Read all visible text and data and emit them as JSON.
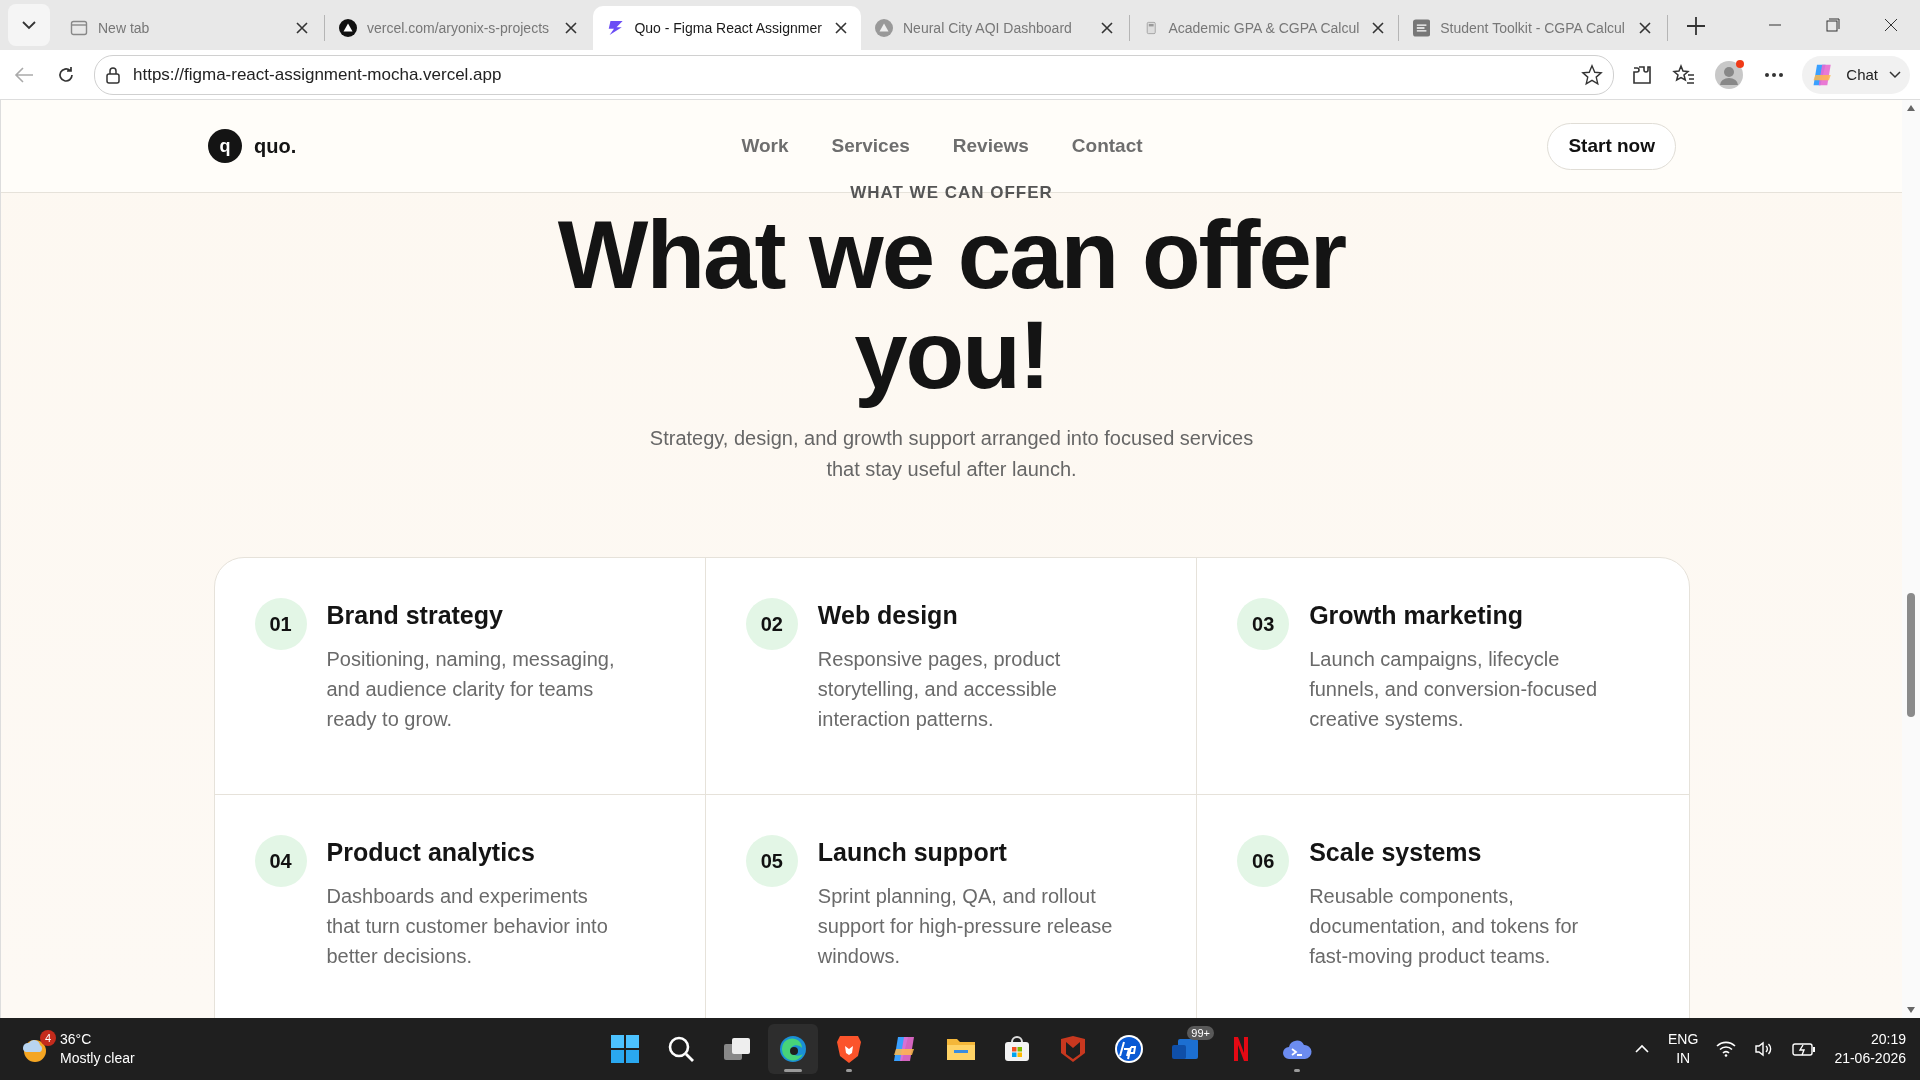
{
  "browser": {
    "tabs": [
      {
        "title": "New tab",
        "kind": "newtab",
        "selected": false
      },
      {
        "title": "vercel.com/aryonix-s-projects",
        "kind": "vercel",
        "selected": false
      },
      {
        "title": "Quo - Figma React Assignmer",
        "kind": "bolt",
        "selected": true
      },
      {
        "title": "Neural City AQI Dashboard",
        "kind": "triangle",
        "selected": false
      },
      {
        "title": "Academic GPA & CGPA Calcul",
        "kind": "calc",
        "selected": false
      },
      {
        "title": "Student Toolkit - CGPA Calcul",
        "kind": "doc",
        "selected": false
      }
    ],
    "address": "https://figma-react-assignment-mocha.vercel.app",
    "chat_label": "Chat",
    "profile_alert": true
  },
  "site": {
    "logo_mark": "q",
    "logo_text": "quo.",
    "nav": [
      "Work",
      "Services",
      "Reviews",
      "Contact"
    ],
    "cta": "Start now"
  },
  "hero": {
    "eyebrow": "WHAT WE CAN OFFER",
    "title_lines": [
      "What we can offer",
      "you!"
    ],
    "subtitle": "Strategy, design, and growth support arranged into focused services that stay useful after launch."
  },
  "services": [
    {
      "number": "01",
      "title": "Brand strategy",
      "description": "Positioning, naming, messaging, and audience clarity for teams ready to grow."
    },
    {
      "number": "02",
      "title": "Web design",
      "description": "Responsive pages, product storytelling, and accessible interaction patterns."
    },
    {
      "number": "03",
      "title": "Growth marketing",
      "description": "Launch campaigns, lifecycle funnels, and conversion-focused creative systems."
    },
    {
      "number": "04",
      "title": "Product analytics",
      "description": "Dashboards and experiments that turn customer behavior into better decisions."
    },
    {
      "number": "05",
      "title": "Launch support",
      "description": "Sprint planning, QA, and rollout support for high-pressure release windows."
    },
    {
      "number": "06",
      "title": "Scale systems",
      "description": "Reusable components, documentation, and tokens for fast-moving product teams."
    }
  ],
  "taskbar": {
    "weather": {
      "temp": "36°C",
      "condition": "Mostly clear",
      "badge": "4"
    },
    "apps": [
      {
        "kind": "start",
        "running": false
      },
      {
        "kind": "search",
        "running": false
      },
      {
        "kind": "taskview",
        "running": false
      },
      {
        "kind": "edge",
        "running": true
      },
      {
        "kind": "brave",
        "running": true
      },
      {
        "kind": "copilot",
        "running": false
      },
      {
        "kind": "files",
        "running": false
      },
      {
        "kind": "store",
        "running": false
      },
      {
        "kind": "shield",
        "running": false
      },
      {
        "kind": "hp",
        "running": false
      },
      {
        "kind": "mail",
        "running": false,
        "badge": "99+"
      },
      {
        "kind": "netflix",
        "running": false
      },
      {
        "kind": "terminal",
        "running": true
      }
    ],
    "language": [
      "ENG",
      "IN"
    ],
    "time": "20:19",
    "date": "21-06-2026"
  }
}
